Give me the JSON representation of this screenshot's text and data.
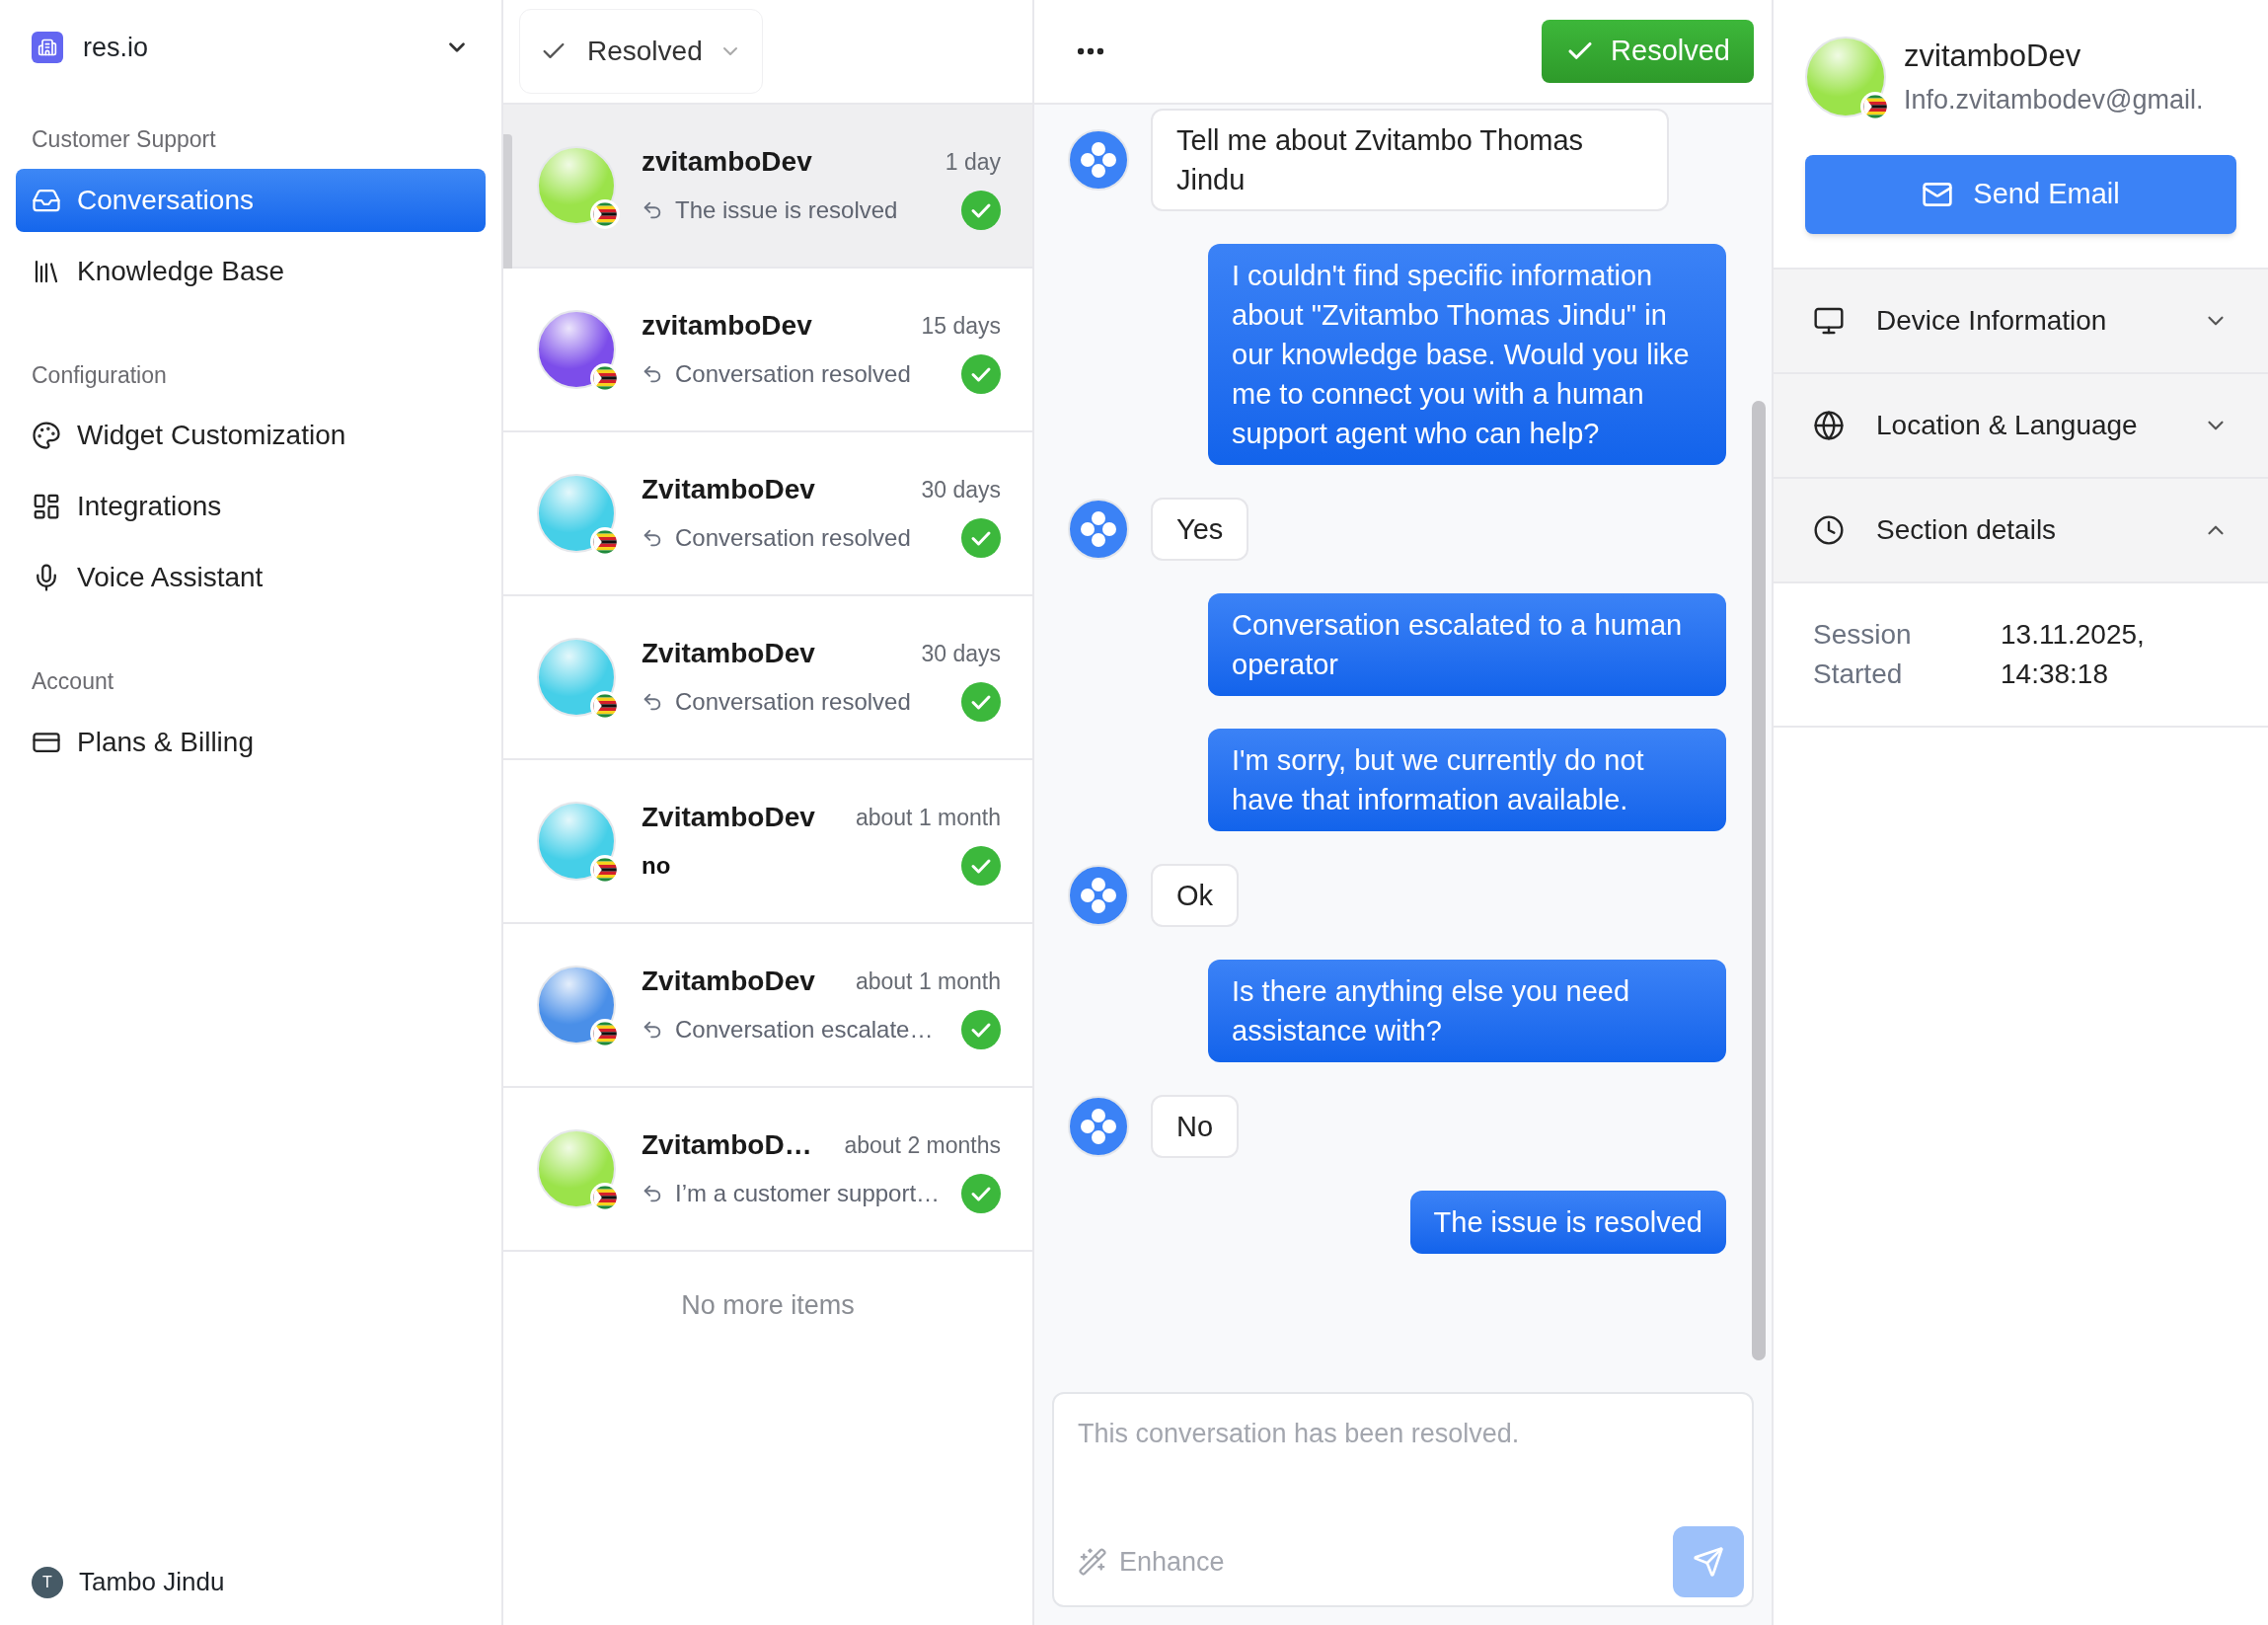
{
  "workspace": {
    "name": "res.io"
  },
  "nav_sections": [
    {
      "title": "Customer Support",
      "items": [
        {
          "label": "Conversations",
          "selected": true
        },
        {
          "label": "Knowledge Base",
          "selected": false
        }
      ]
    },
    {
      "title": "Configuration",
      "items": [
        {
          "label": "Widget Customization",
          "selected": false
        },
        {
          "label": "Integrations",
          "selected": false
        },
        {
          "label": "Voice Assistant",
          "selected": false
        }
      ]
    },
    {
      "title": "Account",
      "items": [
        {
          "label": "Plans & Billing",
          "selected": false
        }
      ]
    }
  ],
  "user": {
    "initial": "T",
    "name": "Tambo Jindu"
  },
  "conversation_filter": {
    "label": "Resolved"
  },
  "conversations": [
    {
      "name": "zvitamboDev",
      "time": "1 day",
      "preview": "The issue is resolved",
      "replied": true,
      "color": "#9be34a",
      "selected": true
    },
    {
      "name": "zvitamboDev",
      "time": "15 days",
      "preview": "Conversation resolved",
      "replied": true,
      "color": "#7c4dea",
      "selected": false
    },
    {
      "name": "ZvitamboDev",
      "time": "30 days",
      "preview": "Conversation resolved",
      "replied": true,
      "color": "#45cfe8",
      "selected": false
    },
    {
      "name": "ZvitamboDev",
      "time": "30 days",
      "preview": "Conversation resolved",
      "replied": true,
      "color": "#45cfe8",
      "selected": false
    },
    {
      "name": "ZvitamboDev",
      "time": "about 1 month",
      "preview": "no",
      "replied": false,
      "color": "#45cfe8",
      "selected": false
    },
    {
      "name": "ZvitamboDev",
      "time": "about 1 month",
      "preview": "Conversation escalate…",
      "replied": true,
      "color": "#4a8fe8",
      "selected": false
    },
    {
      "name": "ZvitamboD…",
      "time": "about 2 months",
      "preview": "I’m a customer support…",
      "replied": true,
      "color": "#9be34a",
      "selected": false
    }
  ],
  "list_footer": "No more items",
  "chat": {
    "status_button": "Resolved",
    "messages": [
      {
        "kind": "incoming",
        "text": "Tell me about Zvitambo Thomas Jindu"
      },
      {
        "kind": "outgoing",
        "text": "I couldn't find specific information about \"Zvitambo Thomas Jindu\" in our knowledge base. Would you like me to connect you with a human support agent who can help?"
      },
      {
        "kind": "incoming",
        "text": "Yes"
      },
      {
        "kind": "outgoing",
        "text": "Conversation escalated to a human operator"
      },
      {
        "kind": "outgoing",
        "text": "I'm sorry, but we currently do not have that information available."
      },
      {
        "kind": "incoming",
        "text": "Ok"
      },
      {
        "kind": "outgoing",
        "text": "Is there anything else you need assistance with?"
      },
      {
        "kind": "incoming",
        "text": "No"
      },
      {
        "kind": "outgoing",
        "text": "The issue is resolved"
      }
    ],
    "composer": {
      "placeholder": "This conversation has been resolved.",
      "enhance": "Enhance"
    }
  },
  "contact": {
    "name": "zvitamboDev",
    "email": "Info.zvitambodev@gmail.",
    "color": "#9be34a",
    "button": "Send Email",
    "sections": [
      {
        "title": "Device Information",
        "expanded": false
      },
      {
        "title": "Location & Language",
        "expanded": false
      },
      {
        "title": "Section details",
        "expanded": true,
        "fields": [
          {
            "label": "Session Started",
            "value": "13.11.2025, 14:38:18"
          }
        ]
      }
    ]
  }
}
